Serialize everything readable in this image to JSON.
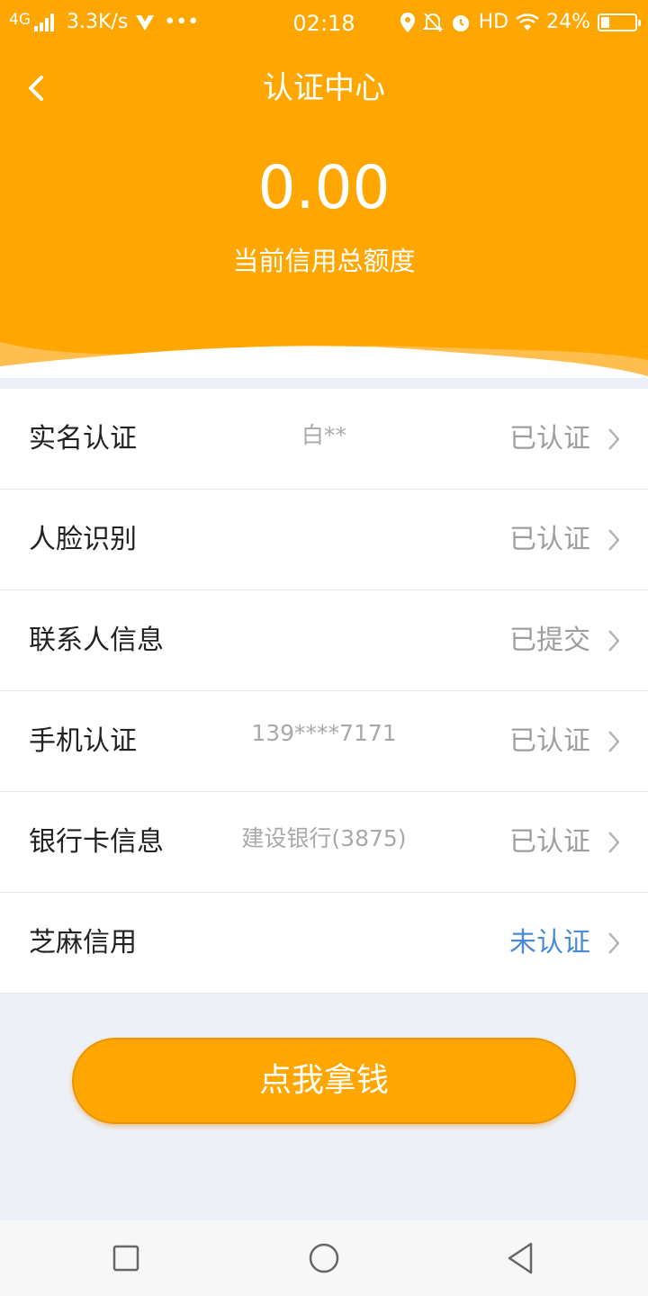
{
  "status_bar": {
    "network": "4G",
    "speed": "3.3K/s",
    "more": "•••",
    "time": "02:18",
    "hd": "HD",
    "battery": "24%",
    "icons": [
      "signal-icon",
      "vee-icon",
      "location-icon",
      "mute-icon",
      "alarm-icon",
      "wifi-icon",
      "battery-icon"
    ]
  },
  "header": {
    "title": "认证中心",
    "amount": "0.00",
    "amount_label": "当前信用总额度",
    "back_icon": "chevron-left-icon"
  },
  "verifications": [
    {
      "label": "实名认证",
      "detail": "白**",
      "status": "已认证"
    },
    {
      "label": "人脸识别",
      "detail": "",
      "status": "已认证"
    },
    {
      "label": "联系人信息",
      "detail": "",
      "status": "已提交"
    },
    {
      "label": "手机认证",
      "detail": "139****7171",
      "status": "已认证"
    },
    {
      "label": "银行卡信息",
      "detail": "建设银行(3875)",
      "status": "已认证"
    },
    {
      "label": "芝麻信用",
      "detail": "",
      "status": "未认证"
    }
  ],
  "cta": {
    "label": "点我拿钱"
  },
  "colors": {
    "brand": "#ffa700",
    "pending_status": "#4a8ad7",
    "done_status": "#9e9e9e",
    "page_bg": "#edf1f7"
  },
  "nav": {
    "icons": [
      "recent-apps-icon",
      "home-icon",
      "back-icon"
    ]
  }
}
